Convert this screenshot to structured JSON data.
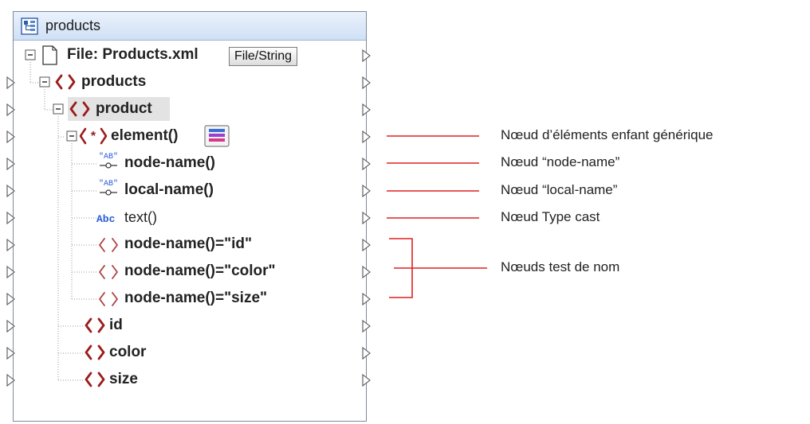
{
  "component": {
    "title": "products",
    "file_label": "File: Products.xml",
    "file_button": "File/String"
  },
  "tree": [
    {
      "label": "products"
    },
    {
      "label": "product"
    },
    {
      "label": "element()"
    },
    {
      "label": "node-name()"
    },
    {
      "label": "local-name()"
    },
    {
      "label": "text()"
    },
    {
      "label": "node-name()=\"id\""
    },
    {
      "label": "node-name()=\"color\""
    },
    {
      "label": "node-name()=\"size\""
    },
    {
      "label": "id"
    },
    {
      "label": "color"
    },
    {
      "label": "size"
    }
  ],
  "icons": {
    "text_type": "Abc",
    "ab_badge": "AB",
    "wildcard": "(*)"
  },
  "annotations": {
    "generic_child": "Nœud d’éléments enfant générique",
    "node_name": "Nœud “node-name”",
    "local_name": "Nœud “local-name”",
    "type_cast": "Nœud Type cast",
    "name_test": "Nœuds test de nom"
  },
  "colors": {
    "annotation_line": "#e02020",
    "element_icon": "#9b1c1c",
    "header_fill": "#cfe0f5",
    "text_icon": "#2a5bd7"
  }
}
